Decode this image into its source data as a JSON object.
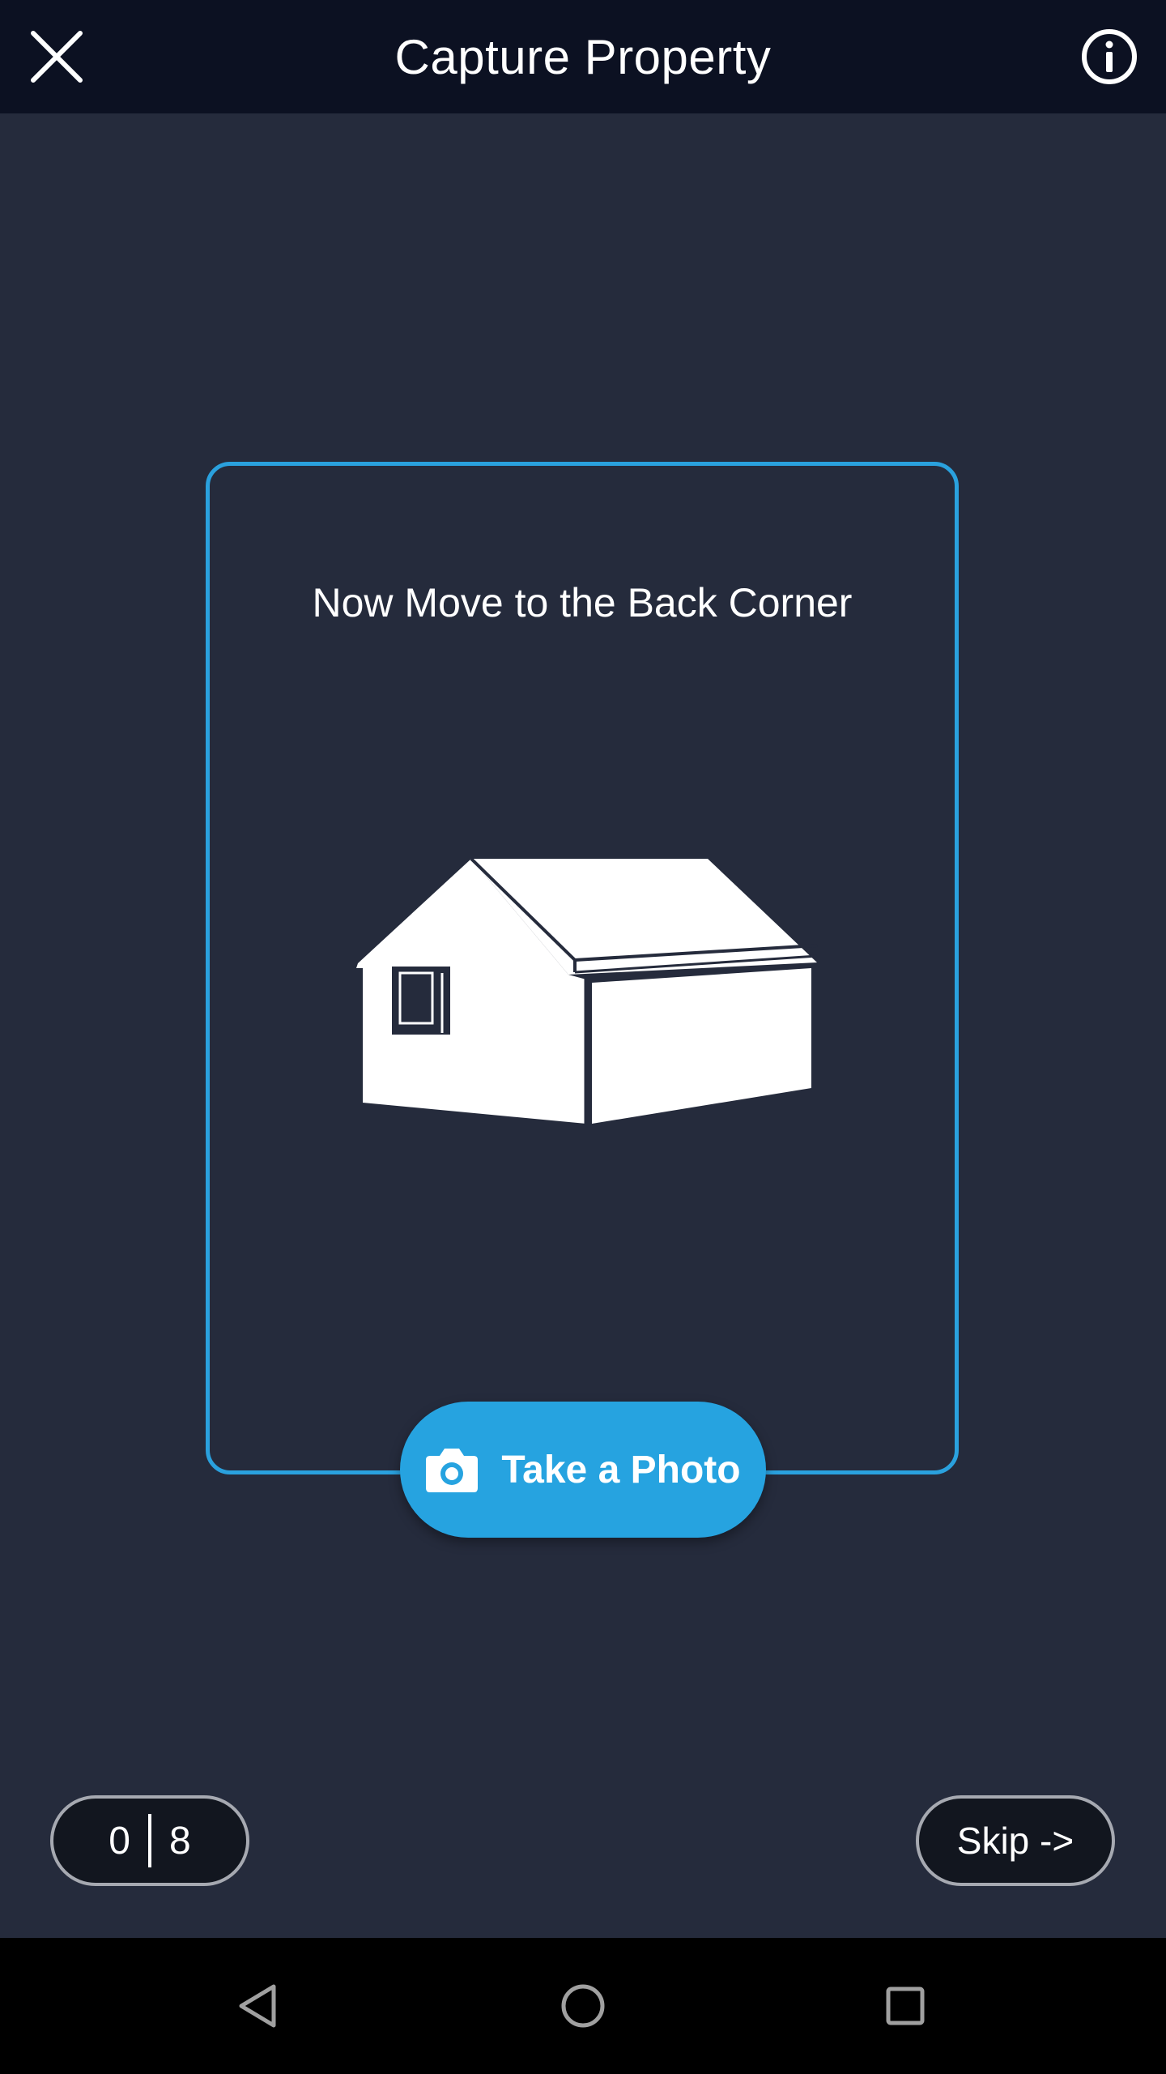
{
  "app_bar": {
    "title": "Capture Property",
    "close_icon": "close-icon",
    "info_icon": "info-icon"
  },
  "capture": {
    "instruction": "Now Move to the Back Corner",
    "illustration": "house-icon",
    "frame_color": "#2aa1de"
  },
  "take_photo": {
    "label": "Take a Photo",
    "icon": "camera-icon",
    "color": "#26a3e0"
  },
  "counter": {
    "current": "0",
    "total": "8"
  },
  "skip": {
    "label": "Skip ->"
  },
  "nav": {
    "back_icon": "back-triangle-icon",
    "home_icon": "home-circle-icon",
    "recent_icon": "recent-square-icon"
  },
  "colors": {
    "background": "#252b3c",
    "app_bar": "#0c1122",
    "accent": "#26a3e0"
  }
}
